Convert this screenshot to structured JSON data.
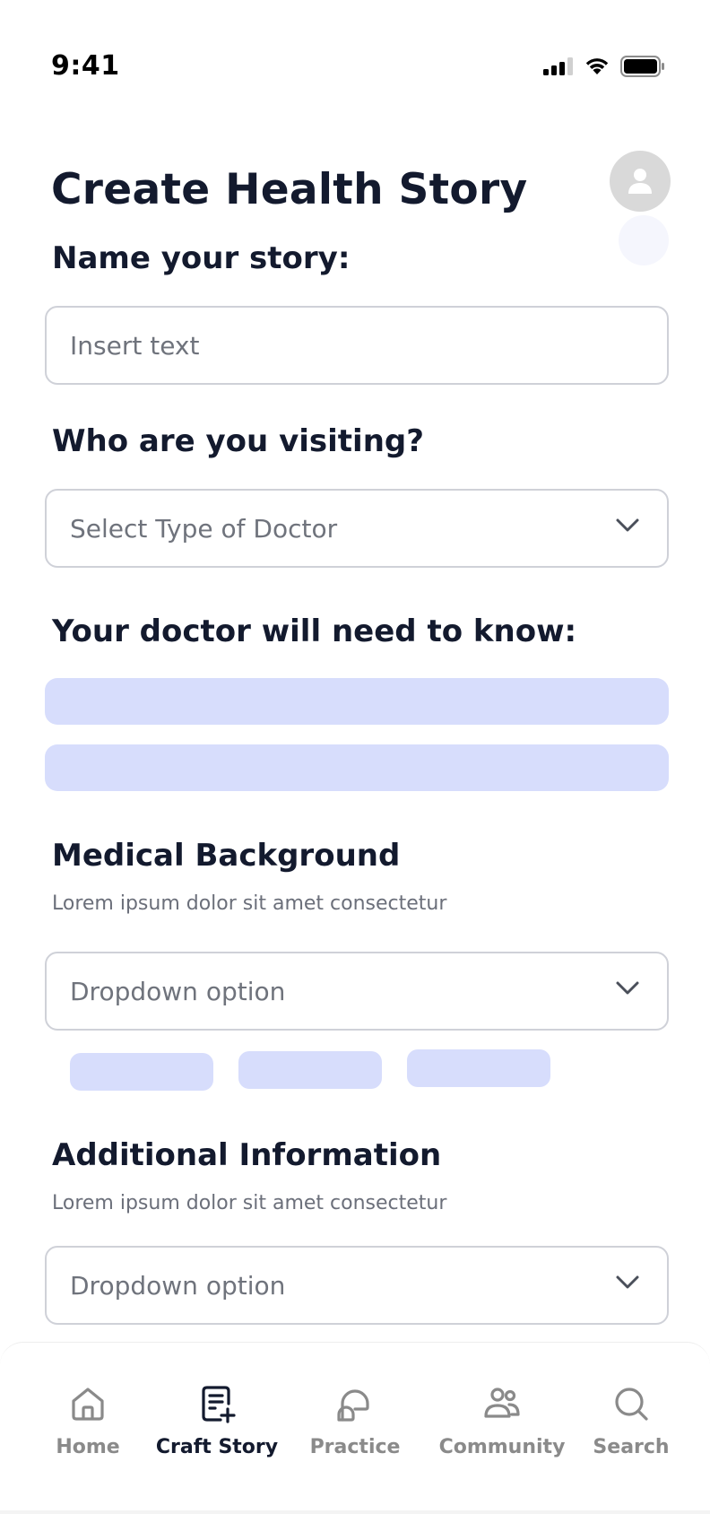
{
  "status_bar": {
    "time": "9:41"
  },
  "header": {
    "title": "Create Health Story"
  },
  "story_name": {
    "label": "Name your story:",
    "placeholder": "Insert text",
    "value": ""
  },
  "doctor_type": {
    "label": "Who are you visiting?",
    "placeholder": "Select Type of Doctor"
  },
  "doctor_needs": {
    "label": "Your doctor will need to know:"
  },
  "medical_background": {
    "label": "Medical Background",
    "description": "Lorem ipsum dolor sit amet consectetur",
    "dropdown_value": "Dropdown option"
  },
  "additional_information": {
    "label": "Additional Information",
    "description": "Lorem ipsum dolor sit amet consectetur",
    "dropdown_value": "Dropdown option"
  },
  "bottom_nav": {
    "items": [
      {
        "label": "Home",
        "icon": "home-icon",
        "active": false
      },
      {
        "label": "Craft Story",
        "icon": "craft-story-icon",
        "active": true
      },
      {
        "label": "Practice",
        "icon": "chat-bubbles-icon",
        "active": false
      },
      {
        "label": "Community",
        "icon": "people-icon",
        "active": false
      },
      {
        "label": "Search",
        "icon": "search-icon",
        "active": false
      }
    ]
  },
  "colors": {
    "text_primary": "#131a2e",
    "text_muted": "#6f737c",
    "placeholder_fill": "#d7ddfc",
    "field_border": "#cfd1d8",
    "nav_inactive": "#8a8a8a",
    "avatar_bg": "#d9d9d9"
  }
}
